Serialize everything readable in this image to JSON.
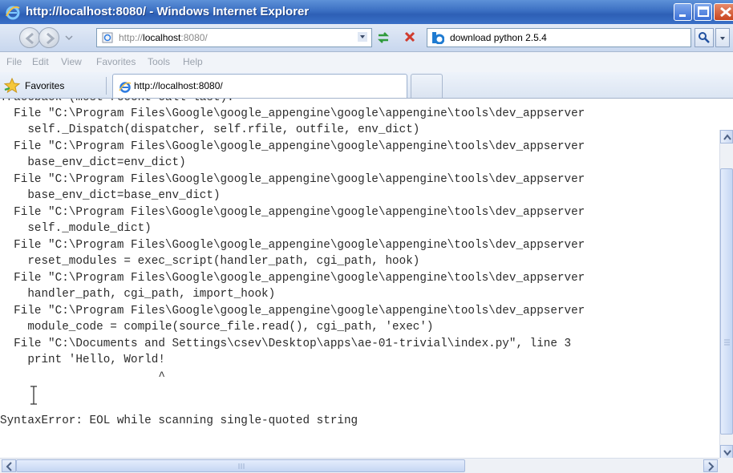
{
  "window": {
    "title": "http://localhost:8080/ - Windows Internet Explorer",
    "icon": "ie-icon",
    "buttons": [
      "minimize-icon",
      "maximize-icon",
      "close-icon"
    ]
  },
  "navigation": {
    "address_prefix": "http://",
    "address_host": "localhost",
    "address_port": ":8080/",
    "search_text": "download python 2.5.4",
    "icons": [
      "back-arrow-icon",
      "forward-arrow-icon",
      "page-icon",
      "refresh-icon",
      "stop-icon",
      "search-icon"
    ]
  },
  "menu": {
    "items": [
      "File",
      "Edit",
      "View",
      "Favorites",
      "Tools",
      "Help"
    ]
  },
  "favorites_bar": {
    "favorites_label": "Favorites",
    "tab_label": "http://localhost:8080/"
  },
  "content": {
    "lines": [
      "Traceback (most recent call last):",
      "  File \"C:\\Program Files\\Google\\google_appengine\\google\\appengine\\tools\\dev_appserver",
      "    self._Dispatch(dispatcher, self.rfile, outfile, env_dict)",
      "  File \"C:\\Program Files\\Google\\google_appengine\\google\\appengine\\tools\\dev_appserver",
      "    base_env_dict=env_dict)",
      "  File \"C:\\Program Files\\Google\\google_appengine\\google\\appengine\\tools\\dev_appserver",
      "    base_env_dict=base_env_dict)",
      "  File \"C:\\Program Files\\Google\\google_appengine\\google\\appengine\\tools\\dev_appserver",
      "    self._module_dict)",
      "  File \"C:\\Program Files\\Google\\google_appengine\\google\\appengine\\tools\\dev_appserver",
      "    reset_modules = exec_script(handler_path, cgi_path, hook)",
      "  File \"C:\\Program Files\\Google\\google_appengine\\google\\appengine\\tools\\dev_appserver",
      "    handler_path, cgi_path, import_hook)",
      "  File \"C:\\Program Files\\Google\\google_appengine\\google\\appengine\\tools\\dev_appserver",
      "    module_code = compile(source_file.read(), cgi_path, 'exec')",
      "  File \"C:\\Documents and Settings\\csev\\Desktop\\apps\\ae-01-trivial\\index.py\", line 3",
      "    print 'Hello, World!",
      "                       ^",
      "",
      "SyntaxError: EOL while scanning single-quoted string"
    ]
  }
}
